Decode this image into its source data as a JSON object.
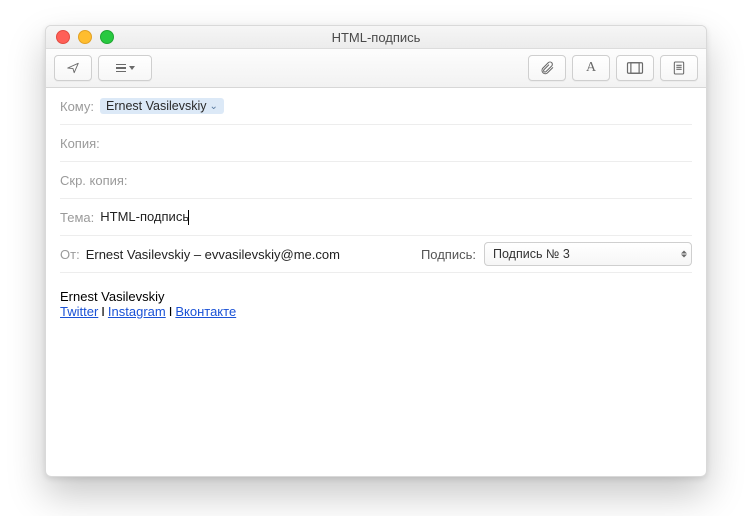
{
  "window": {
    "title": "HTML-подпись"
  },
  "toolbar": {
    "icons": {
      "send": "send-icon",
      "list": "list-icon",
      "attach": "attach-icon",
      "font": "font-icon",
      "photo": "photo-icon",
      "stationery": "stationery-icon"
    },
    "font_glyph": "A"
  },
  "fields": {
    "to": {
      "label": "Кому:",
      "recipient": "Ernest Vasilevskiy"
    },
    "cc": {
      "label": "Копия:"
    },
    "bcc": {
      "label": "Скр. копия:"
    },
    "subject": {
      "label": "Тема:",
      "value": "HTML-подпись"
    },
    "from": {
      "label": "От:",
      "value": "Ernest Vasilevskiy – evvasilevskiy@me.com"
    },
    "signature": {
      "label": "Подпись:",
      "selected": "Подпись № 3"
    }
  },
  "signature_block": {
    "name": "Ernest Vasilevskiy",
    "links": {
      "twitter": "Twitter",
      "instagram": "Instagram",
      "vk": "Вконтакте"
    },
    "separator": "I"
  }
}
